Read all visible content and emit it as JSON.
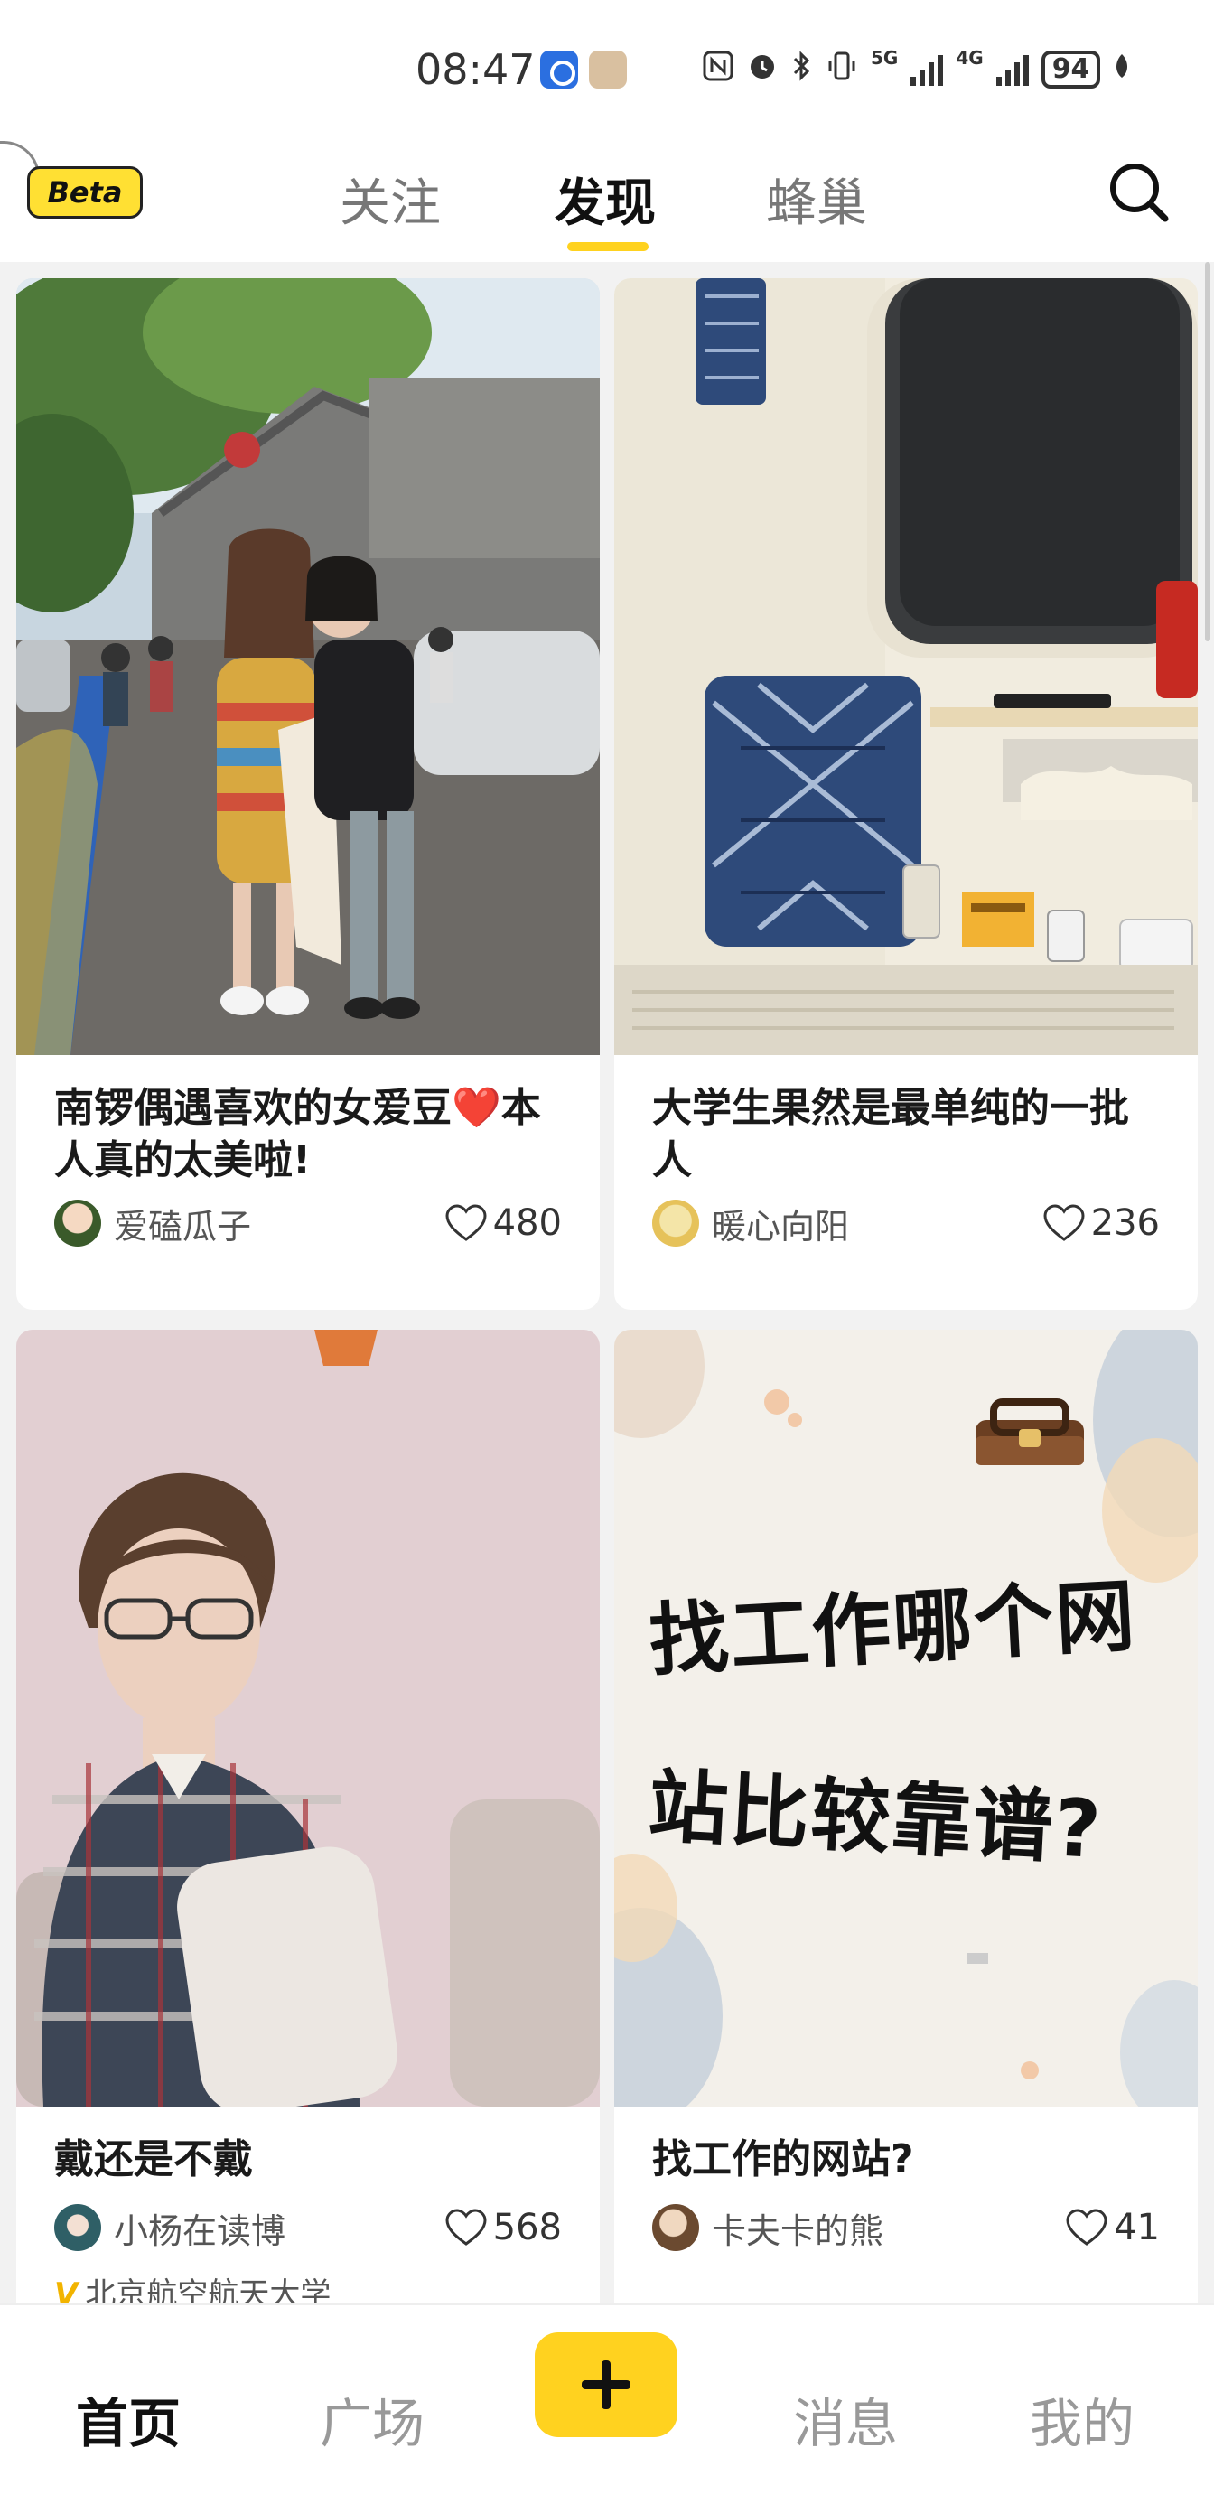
{
  "status_bar": {
    "time": "08:47",
    "network_1": "5G",
    "network_2": "4G",
    "battery": "94"
  },
  "header": {
    "beta_label": "Beta",
    "tabs": [
      {
        "label": "关注",
        "active": false
      },
      {
        "label": "发现",
        "active": true
      },
      {
        "label": "蜂巢",
        "active": false
      }
    ]
  },
  "feed": {
    "posts": [
      {
        "title": "南锣偶遇喜欢的女爱豆❤️本人真的太美啦!",
        "author": "爱磕瓜子",
        "likes": "480"
      },
      {
        "title": "大学生果然是最单纯的一批人",
        "author": "暖心向阳",
        "likes": "236"
      },
      {
        "title": "戴还是不戴",
        "author": "小杨在读博",
        "likes": "568",
        "school": "北京航空航天大学"
      },
      {
        "title": "找工作的网站?",
        "author": "卡夫卡的熊",
        "likes": "41",
        "image_text": [
          "找工作哪个网",
          "站比较靠谱?"
        ]
      }
    ]
  },
  "bottom_nav": {
    "items": [
      {
        "label": "首页",
        "active": true
      },
      {
        "label": "广场",
        "active": false
      },
      {
        "label": "消息",
        "active": false
      },
      {
        "label": "我的",
        "active": false
      }
    ]
  },
  "colors": {
    "accent": "#ffd21f",
    "background": "#f2f2f2"
  }
}
